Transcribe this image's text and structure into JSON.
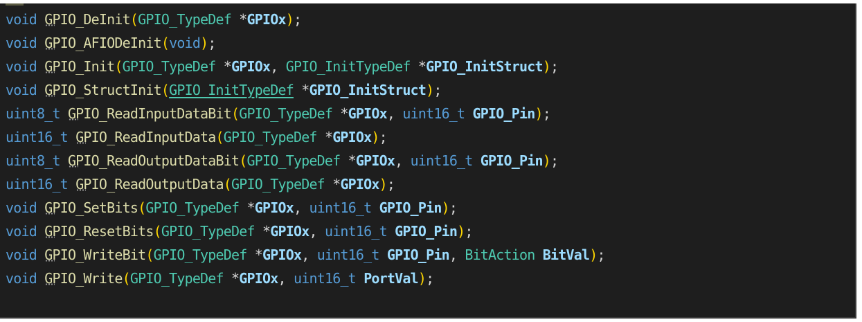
{
  "editor": {
    "lines": [
      [
        [
          "kw",
          "void"
        ],
        [
          "sp",
          " "
        ],
        [
          "fn",
          "GPIO_DeInit"
        ],
        [
          "paren",
          "("
        ],
        [
          "type",
          "GPIO_TypeDef"
        ],
        [
          "sp",
          " "
        ],
        [
          "plain",
          "*"
        ],
        [
          "pbold",
          "GPIOx"
        ],
        [
          "paren",
          ")"
        ],
        [
          "plain",
          ";"
        ]
      ],
      [
        [
          "kw",
          "void"
        ],
        [
          "sp",
          " "
        ],
        [
          "fn",
          "GPIO_AFIODeInit"
        ],
        [
          "paren",
          "("
        ],
        [
          "kw",
          "void"
        ],
        [
          "paren",
          ")"
        ],
        [
          "plain",
          ";"
        ]
      ],
      [
        [
          "kw",
          "void"
        ],
        [
          "sp",
          " "
        ],
        [
          "fn",
          "GPIO_Init"
        ],
        [
          "paren",
          "("
        ],
        [
          "type",
          "GPIO_TypeDef"
        ],
        [
          "sp",
          " "
        ],
        [
          "plain",
          "*"
        ],
        [
          "pbold",
          "GPIOx"
        ],
        [
          "plain",
          ", "
        ],
        [
          "type",
          "GPIO_InitTypeDef"
        ],
        [
          "sp",
          " "
        ],
        [
          "plain",
          "*"
        ],
        [
          "pbold",
          "GPIO_InitStruct"
        ],
        [
          "paren",
          ")"
        ],
        [
          "plain",
          ";"
        ]
      ],
      [
        [
          "kw",
          "void"
        ],
        [
          "sp",
          " "
        ],
        [
          "fn",
          "GPIO_StructInit"
        ],
        [
          "paren",
          "("
        ],
        [
          "link",
          "GPIO_InitTypeDef"
        ],
        [
          "sp",
          " "
        ],
        [
          "plain",
          "*"
        ],
        [
          "pbold",
          "GPIO_InitStruct"
        ],
        [
          "paren",
          ")"
        ],
        [
          "plain",
          ";"
        ]
      ],
      [
        [
          "kw",
          "uint8_t"
        ],
        [
          "sp",
          " "
        ],
        [
          "fn",
          "GPIO_ReadInputDataBit"
        ],
        [
          "paren",
          "("
        ],
        [
          "type",
          "GPIO_TypeDef"
        ],
        [
          "sp",
          " "
        ],
        [
          "plain",
          "*"
        ],
        [
          "pbold",
          "GPIOx"
        ],
        [
          "plain",
          ", "
        ],
        [
          "kw",
          "uint16_t"
        ],
        [
          "sp",
          " "
        ],
        [
          "pbold",
          "GPIO_Pin"
        ],
        [
          "paren",
          ")"
        ],
        [
          "plain",
          ";"
        ]
      ],
      [
        [
          "kw",
          "uint16_t"
        ],
        [
          "sp",
          " "
        ],
        [
          "fn",
          "GPIO_ReadInputData"
        ],
        [
          "paren",
          "("
        ],
        [
          "type",
          "GPIO_TypeDef"
        ],
        [
          "sp",
          " "
        ],
        [
          "plain",
          "*"
        ],
        [
          "pbold",
          "GPIOx"
        ],
        [
          "paren",
          ")"
        ],
        [
          "plain",
          ";"
        ]
      ],
      [
        [
          "kw",
          "uint8_t"
        ],
        [
          "sp",
          " "
        ],
        [
          "fn",
          "GPIO_ReadOutputDataBit"
        ],
        [
          "paren",
          "("
        ],
        [
          "type",
          "GPIO_TypeDef"
        ],
        [
          "sp",
          " "
        ],
        [
          "plain",
          "*"
        ],
        [
          "pbold",
          "GPIOx"
        ],
        [
          "plain",
          ", "
        ],
        [
          "kw",
          "uint16_t"
        ],
        [
          "sp",
          " "
        ],
        [
          "pbold",
          "GPIO_Pin"
        ],
        [
          "paren",
          ")"
        ],
        [
          "plain",
          ";"
        ]
      ],
      [
        [
          "kw",
          "uint16_t"
        ],
        [
          "sp",
          " "
        ],
        [
          "fn",
          "GPIO_ReadOutputData"
        ],
        [
          "paren",
          "("
        ],
        [
          "type",
          "GPIO_TypeDef"
        ],
        [
          "sp",
          " "
        ],
        [
          "plain",
          "*"
        ],
        [
          "pbold",
          "GPIOx"
        ],
        [
          "paren",
          ")"
        ],
        [
          "plain",
          ";"
        ]
      ],
      [
        [
          "kw",
          "void"
        ],
        [
          "sp",
          " "
        ],
        [
          "fn",
          "GPIO_SetBits"
        ],
        [
          "paren",
          "("
        ],
        [
          "type",
          "GPIO_TypeDef"
        ],
        [
          "sp",
          " "
        ],
        [
          "plain",
          "*"
        ],
        [
          "pbold",
          "GPIOx"
        ],
        [
          "plain",
          ", "
        ],
        [
          "kw",
          "uint16_t"
        ],
        [
          "sp",
          " "
        ],
        [
          "pbold",
          "GPIO_Pin"
        ],
        [
          "paren",
          ")"
        ],
        [
          "plain",
          ";"
        ]
      ],
      [
        [
          "kw",
          "void"
        ],
        [
          "sp",
          " "
        ],
        [
          "fn",
          "GPIO_ResetBits"
        ],
        [
          "paren",
          "("
        ],
        [
          "type",
          "GPIO_TypeDef"
        ],
        [
          "sp",
          " "
        ],
        [
          "plain",
          "*"
        ],
        [
          "pbold",
          "GPIOx"
        ],
        [
          "plain",
          ", "
        ],
        [
          "kw",
          "uint16_t"
        ],
        [
          "sp",
          " "
        ],
        [
          "pbold",
          "GPIO_Pin"
        ],
        [
          "paren",
          ")"
        ],
        [
          "plain",
          ";"
        ]
      ],
      [
        [
          "kw",
          "void"
        ],
        [
          "sp",
          " "
        ],
        [
          "fn",
          "GPIO_WriteBit"
        ],
        [
          "paren",
          "("
        ],
        [
          "type",
          "GPIO_TypeDef"
        ],
        [
          "sp",
          " "
        ],
        [
          "plain",
          "*"
        ],
        [
          "pbold",
          "GPIOx"
        ],
        [
          "plain",
          ", "
        ],
        [
          "kw",
          "uint16_t"
        ],
        [
          "sp",
          " "
        ],
        [
          "pbold",
          "GPIO_Pin"
        ],
        [
          "plain",
          ", "
        ],
        [
          "type",
          "BitAction"
        ],
        [
          "sp",
          " "
        ],
        [
          "pbold",
          "BitVal"
        ],
        [
          "paren",
          ")"
        ],
        [
          "plain",
          ";"
        ]
      ],
      [
        [
          "kw",
          "void"
        ],
        [
          "sp",
          " "
        ],
        [
          "fn",
          "GPIO_Write"
        ],
        [
          "paren",
          "("
        ],
        [
          "type",
          "GPIO_TypeDef"
        ],
        [
          "sp",
          " "
        ],
        [
          "plain",
          "*"
        ],
        [
          "pbold",
          "GPIOx"
        ],
        [
          "plain",
          ", "
        ],
        [
          "kw",
          "uint16_t"
        ],
        [
          "sp",
          " "
        ],
        [
          "pbold",
          "PortVal"
        ],
        [
          "paren",
          ")"
        ],
        [
          "plain",
          ";"
        ]
      ]
    ]
  },
  "colors": {
    "background": "#1e1e1e",
    "keyword": "#569cd6",
    "function": "#dcdcaa",
    "type": "#4ec9b0",
    "parameter": "#9cdcfe",
    "punctuation": "#d4d4d4",
    "bracket": "#ffd700"
  }
}
